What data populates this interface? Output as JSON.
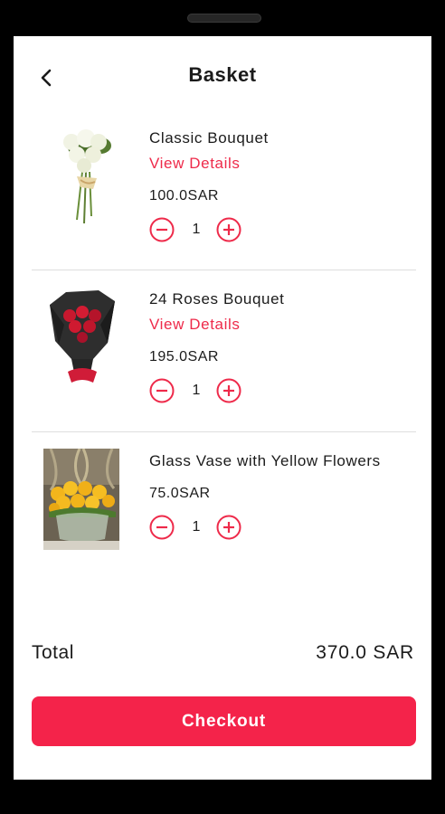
{
  "header": {
    "title": "Basket",
    "back_icon": "chevron-left-icon"
  },
  "accent_color": "#f4234a",
  "items": [
    {
      "name": "Classic Bouquet",
      "details_label": "View Details",
      "price": "100.0SAR",
      "quantity": "1"
    },
    {
      "name": "24 Roses Bouquet",
      "details_label": "View Details",
      "price": "195.0SAR",
      "quantity": "1"
    },
    {
      "name": "Glass Vase with Yellow Flowers",
      "price": "75.0SAR",
      "quantity": "1"
    }
  ],
  "summary": {
    "total_label": "Total",
    "total_value": "370.0 SAR"
  },
  "checkout_label": "Checkout"
}
